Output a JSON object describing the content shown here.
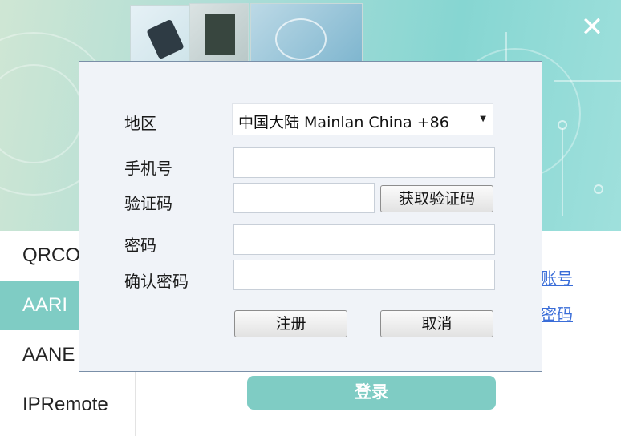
{
  "background": {
    "nav_items": [
      "QRCO",
      "AARI",
      "AANE",
      "IPRemote"
    ],
    "active_nav_index": 1,
    "links": [
      "账号",
      "密码"
    ],
    "login_label": "登录",
    "close_glyph": "✕",
    "accent_color": "#7fccc4"
  },
  "dialog": {
    "region": {
      "label": "地区",
      "value": "中国大陆 Mainlan China +86"
    },
    "phone": {
      "label": "手机号",
      "value": ""
    },
    "code": {
      "label": "验证码",
      "value": "",
      "get_code_label": "获取验证码"
    },
    "password": {
      "label": "密码",
      "value": ""
    },
    "confirm": {
      "label": "确认密码",
      "value": ""
    },
    "register_label": "注册",
    "cancel_label": "取消"
  }
}
